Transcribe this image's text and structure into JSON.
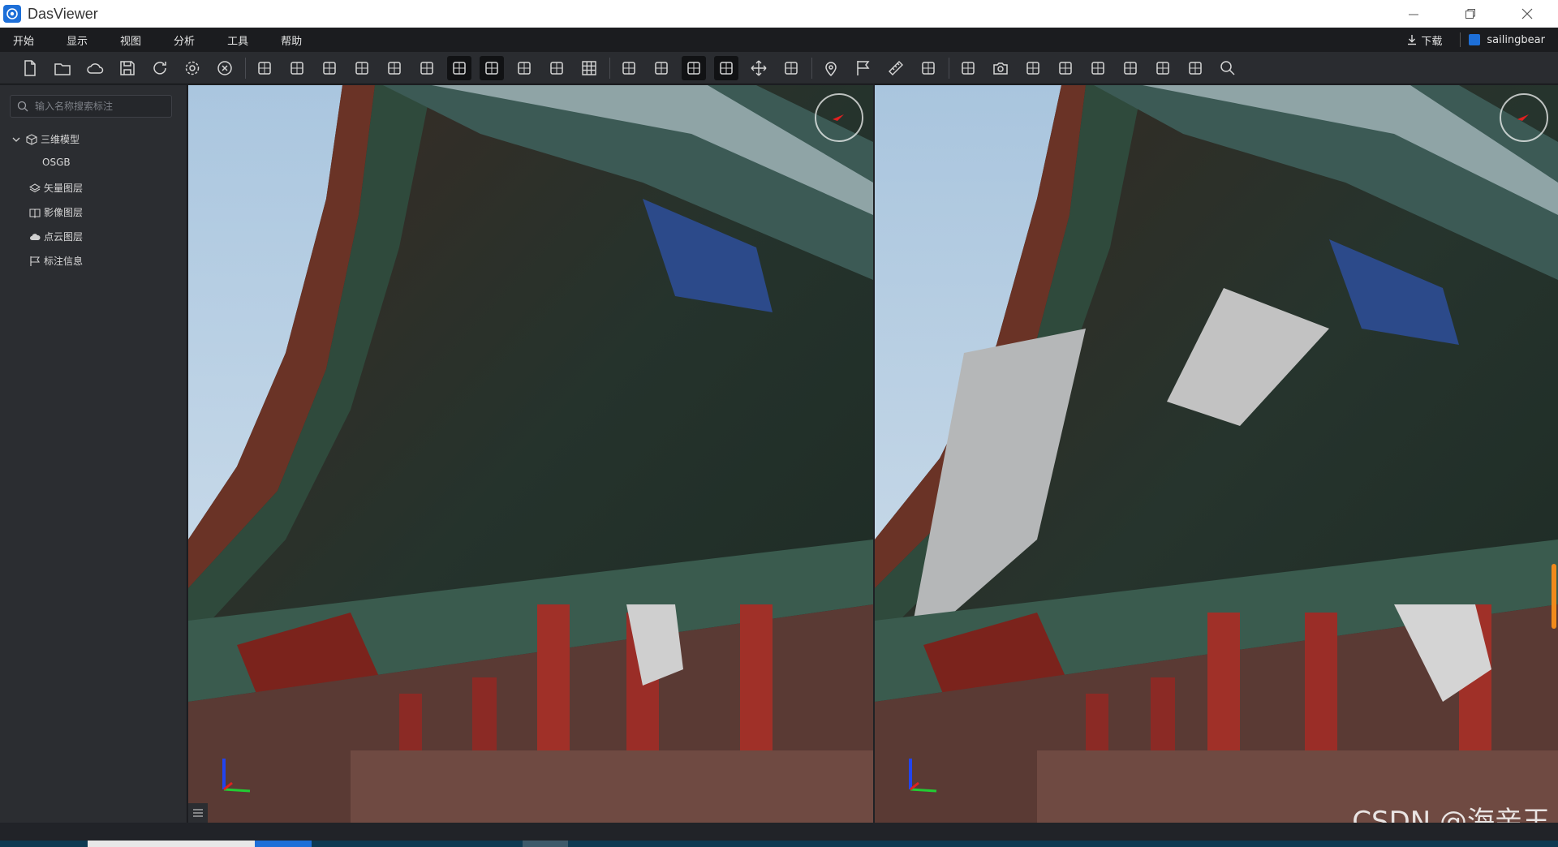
{
  "window": {
    "title": "DasViewer"
  },
  "menu": [
    "开始",
    "显示",
    "视图",
    "分析",
    "工具",
    "帮助"
  ],
  "account": {
    "download_label": "下载",
    "username": "sailingbear"
  },
  "toolbar": {
    "groups": [
      [
        "new-file-icon",
        "open-folder-icon",
        "cloud-icon",
        "save-icon",
        "refresh-icon",
        "settings-icon",
        "close-circle-icon"
      ],
      [
        "import-model-icon",
        "terrain-icon",
        "light-icon",
        "panel-icon",
        "layers-overlay-icon",
        "point-cloud-icon",
        "view-top-icon",
        "view-front-icon",
        "view-side-icon",
        "box-clip-icon",
        "grid-icon"
      ],
      [
        "eye-rotate-icon",
        "fit-view-icon",
        "split-view-icon",
        "flag-mode-icon",
        "pan-icon",
        "eye-lock-icon"
      ],
      [
        "place-marker-icon",
        "flag-icon",
        "ruler-icon",
        "volume-icon"
      ],
      [
        "path-icon",
        "camera-icon",
        "profile-icon",
        "crop-icon",
        "export-doc-icon",
        "chart-icon",
        "image-icon",
        "report-icon",
        "search-icon"
      ]
    ],
    "active": [
      "view-top-icon",
      "view-front-icon",
      "split-view-icon",
      "flag-mode-icon"
    ]
  },
  "sidebar": {
    "search_placeholder": "输入名称搜索标注",
    "tree": [
      {
        "label": "三维模型",
        "icon": "cube-icon",
        "expanded": true,
        "children": [
          {
            "label": "OSGB"
          }
        ]
      },
      {
        "label": "矢量图层",
        "icon": "layers-icon"
      },
      {
        "label": "影像图层",
        "icon": "book-icon"
      },
      {
        "label": "点云图层",
        "icon": "cloud-icon"
      },
      {
        "label": "标注信息",
        "icon": "flag-icon"
      }
    ]
  },
  "watermark": "CSDN @海亲王",
  "colors": {
    "accent": "#1d6fd8",
    "menu_bg": "#1b1c1f",
    "toolbar_bg": "#2a2c30",
    "sidebar_bg": "#2b2d31"
  }
}
